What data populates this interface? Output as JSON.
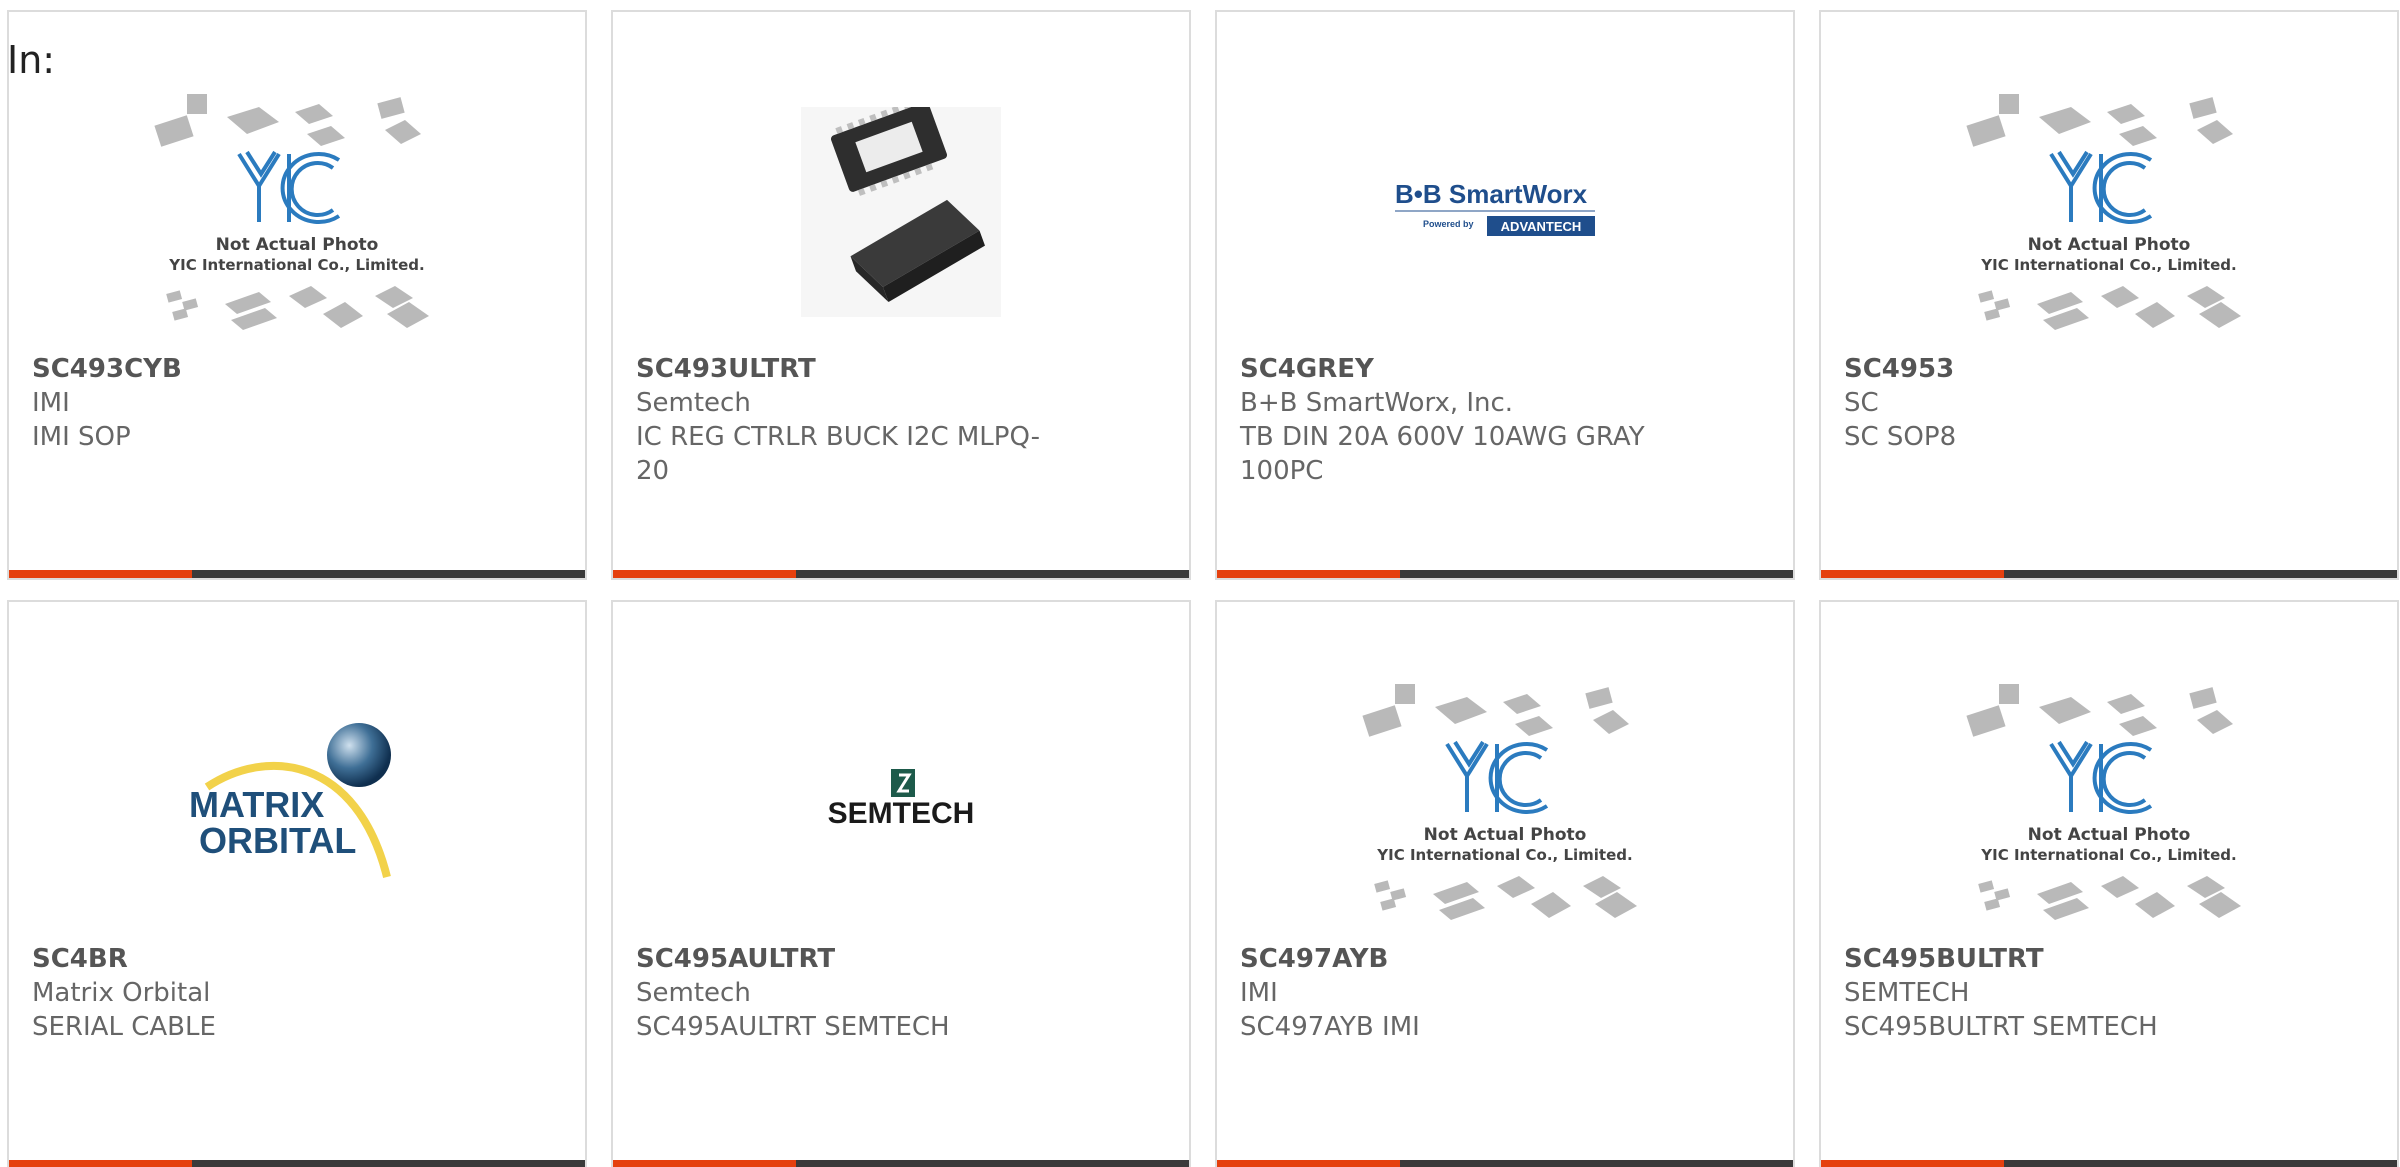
{
  "header": {
    "in_label": "In:"
  },
  "colors": {
    "accent": "#e5400e",
    "bar": "#3a3a3a",
    "text": "#666666"
  },
  "cards": [
    {
      "part": "SC493CYB",
      "manufacturer": "IMI",
      "description": "IMI SOP",
      "image_icon": "yic-placeholder-icon",
      "image_text": {
        "line1": "Not Actual Photo",
        "line2": "YIC International Co., Limited.",
        "logo": "YIC"
      }
    },
    {
      "part": "SC493ULTRT",
      "manufacturer": "Semtech",
      "description": "IC REG CTRLR BUCK I2C MLPQ-20",
      "image_icon": "qfn-chip-icon"
    },
    {
      "part": "SC4GREY",
      "manufacturer": "B+B SmartWorx, Inc.",
      "description": "TB DIN 20A 600V 10AWG GRAY 100PC",
      "image_icon": "bb-smartworx-logo",
      "image_text": {
        "logo_main": "B•B SmartWorx",
        "powered_by": "Powered by",
        "advantech": "ADVANTECH"
      }
    },
    {
      "part": "SC4953",
      "manufacturer": "SC",
      "description": "SC SOP8",
      "image_icon": "yic-placeholder-icon",
      "image_text": {
        "line1": "Not Actual Photo",
        "line2": "YIC International Co., Limited.",
        "logo": "YIC"
      }
    },
    {
      "part": "SC4BR",
      "manufacturer": "Matrix Orbital",
      "description": "SERIAL CABLE",
      "image_icon": "matrix-orbital-logo",
      "image_text": {
        "line1": "MATRIX",
        "line2": "ORBITAL"
      }
    },
    {
      "part": "SC495AULTRT",
      "manufacturer": "Semtech",
      "description": "SC495AULTRT SEMTECH",
      "image_icon": "semtech-logo",
      "image_text": {
        "logo": "SEMTECH"
      }
    },
    {
      "part": "SC497AYB",
      "manufacturer": "IMI",
      "description": "SC497AYB IMI",
      "image_icon": "yic-placeholder-icon",
      "image_text": {
        "line1": "Not Actual Photo",
        "line2": "YIC International Co., Limited.",
        "logo": "YIC"
      }
    },
    {
      "part": "SC495BULTRT",
      "manufacturer": "SEMTECH",
      "description": "SC495BULTRT SEMTECH",
      "image_icon": "yic-placeholder-icon",
      "image_text": {
        "line1": "Not Actual Photo",
        "line2": "YIC International Co., Limited.",
        "logo": "YIC"
      }
    }
  ]
}
